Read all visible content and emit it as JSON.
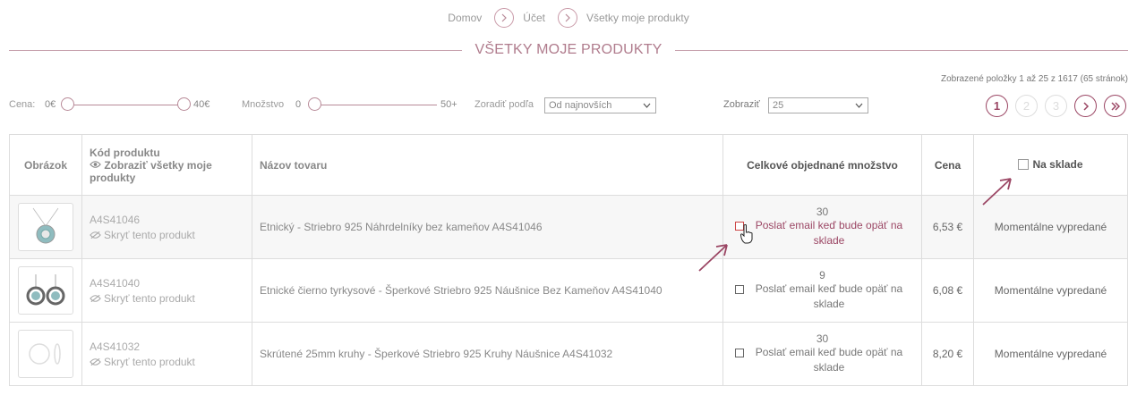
{
  "breadcrumb": {
    "home": "Domov",
    "account": "Účet",
    "current": "Všetky moje produkty"
  },
  "page_title": "VŠETKY MOJE PRODUKTY",
  "items_info": "Zobrazené položky 1 až 25 z 1617 (65 stránok)",
  "filters": {
    "price_label": "Cena:",
    "price_min": "0€",
    "price_max": "40€",
    "qty_label": "Množstvo",
    "qty_min": "0",
    "qty_max": "50+",
    "sort_label": "Zoradiť podľa",
    "sort_value": "Od najnovších",
    "show_label": "Zobraziť",
    "show_value": "25"
  },
  "pagination": {
    "pages": [
      "1",
      "2",
      "3"
    ],
    "current": "1"
  },
  "table": {
    "headers": {
      "image": "Obrázok",
      "code": "Kód produktu",
      "show_all": "Zobraziť všetky moje produkty",
      "name": "Názov tovaru",
      "qty": "Celkové objednané množstvo",
      "price": "Cena",
      "stock": "Na sklade"
    },
    "rows": [
      {
        "code": "A4S41046",
        "hide": "Skryť tento produkt",
        "name": "Etnický - Striebro 925 Náhrdelníky bez kameňov A4S41046",
        "qty": "30",
        "notify": "Poslať email keď bude opäť na sklade",
        "price": "6,53 €",
        "stock": "Momentálne vypredané"
      },
      {
        "code": "A4S41040",
        "hide": "Skryť tento produkt",
        "name": "Etnické čierno tyrkysové - Šperkové Striebro 925 Náušnice Bez Kameňov A4S41040",
        "qty": "9",
        "notify": "Poslať email keď bude opäť na sklade",
        "price": "6,08 €",
        "stock": "Momentálne vypredané"
      },
      {
        "code": "A4S41032",
        "hide": "Skryť tento produkt",
        "name": "Skrútené 25mm kruhy - Šperkové Striebro 925 Kruhy Náušnice A4S41032",
        "qty": "30",
        "notify": "Poslať email keď bude opäť na sklade",
        "price": "8,20 €",
        "stock": "Momentálne vypredané"
      }
    ]
  },
  "colors": {
    "accent": "#9b4664",
    "border": "#dddddd",
    "title": "#b07c8d"
  }
}
